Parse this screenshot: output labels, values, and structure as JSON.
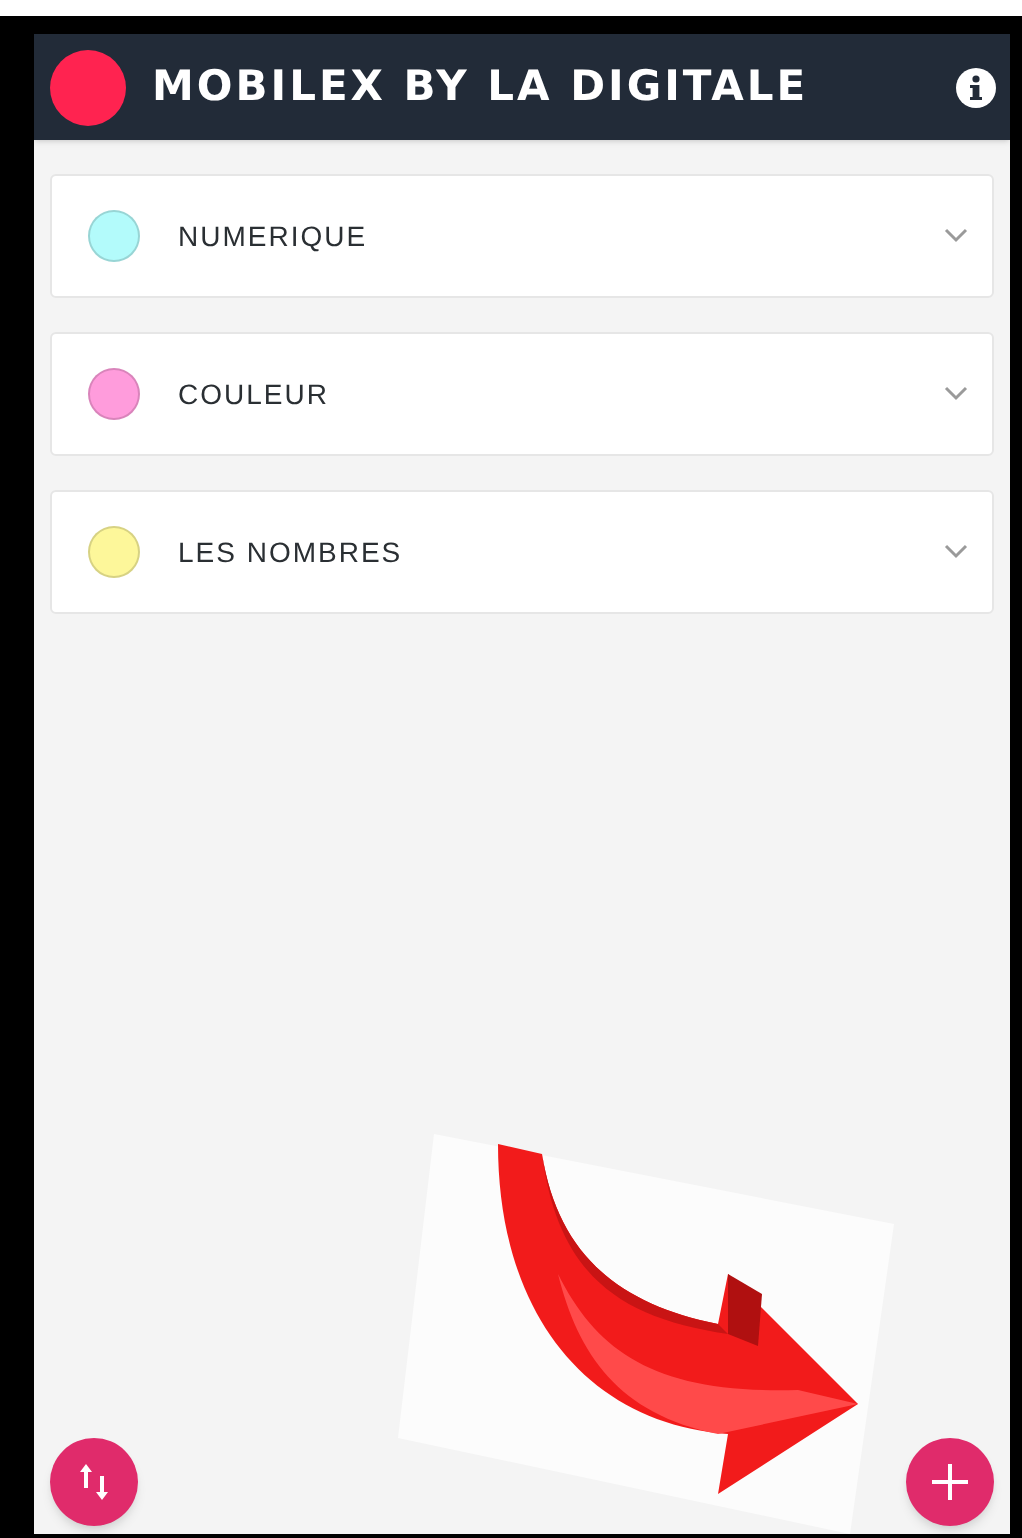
{
  "app_bar": {
    "title": "MOBILEX BY LA DIGITALE"
  },
  "categories": [
    {
      "label": "NUMERIQUE",
      "color": "#b3fbfb",
      "expanded": false
    },
    {
      "label": "COULEUR",
      "color": "#ff9cdc",
      "expanded": false
    },
    {
      "label": "LES NOMBRES",
      "color": "#fdf79a",
      "expanded": false
    }
  ]
}
